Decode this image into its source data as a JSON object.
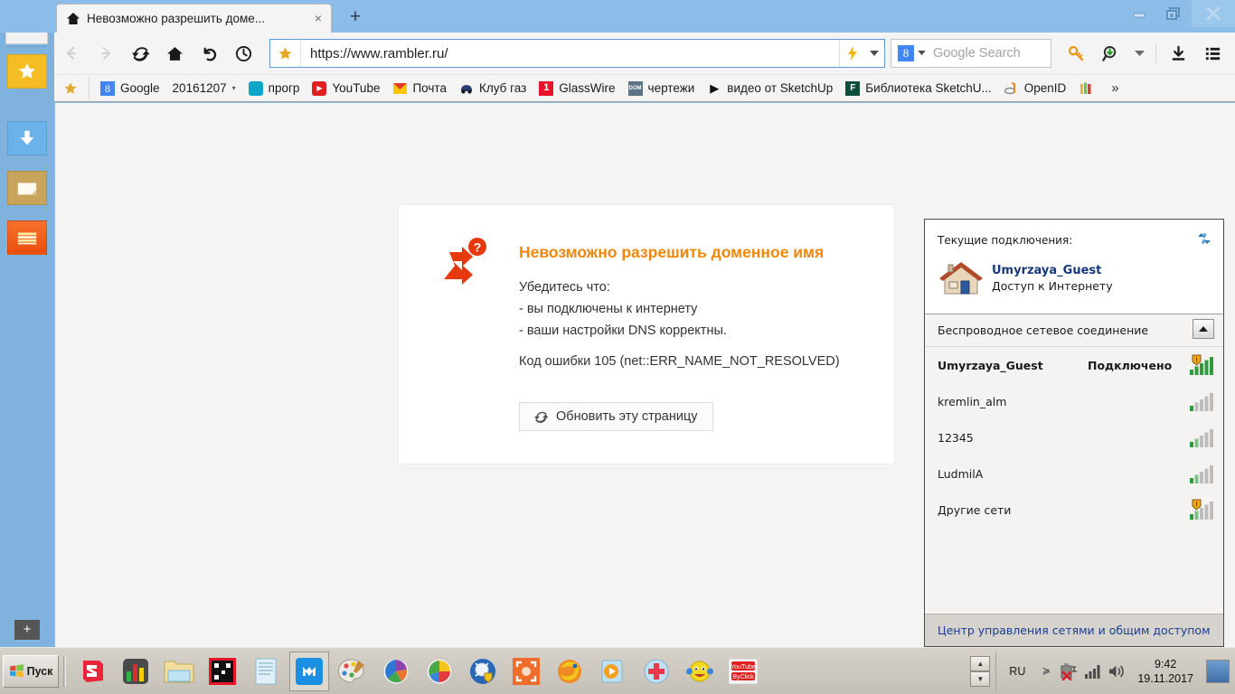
{
  "window": {
    "minimize_label": "Minimize",
    "maximize_label": "Restore",
    "close_label": "Close"
  },
  "tab": {
    "title": "Невозможно разрешить доме...",
    "close_label": "×",
    "newtab_label": "+",
    "home_icon": "home-icon"
  },
  "toolbar": {
    "back_label": "←",
    "forward_label": "→",
    "reload_label": "reload-icon",
    "home_label": "home-icon",
    "undo_label": "undo-icon",
    "history_label": "clock-icon",
    "url": "https://www.rambler.ru/",
    "star_icon": "star-icon",
    "lightning_icon": "lightning-icon",
    "caret_icon": "chevron-down-icon",
    "search_engine": "8",
    "search_placeholder": "Google Search",
    "key_icon": "key-icon",
    "resource_sniffer_icon": "magnifier-download-icon",
    "extras_caret": "chevron-down-icon",
    "download_icon": "download-icon",
    "menu_icon": "hamburger-menu-icon"
  },
  "bookmarks": {
    "star_label": "★",
    "items": [
      {
        "label": "Google",
        "icon": "google-icon",
        "icon_text": "8",
        "icon_bg": "#4285f4",
        "icon_color": "#ffffff"
      },
      {
        "label": "20161207",
        "icon": "folder-icon",
        "icon_text": "",
        "icon_bg": "transparent",
        "icon_color": "#555555",
        "caret": "▾"
      },
      {
        "label": "прогр",
        "icon": "square-icon",
        "icon_text": "",
        "icon_bg": "#0fa5c8",
        "icon_color": "#ffffff"
      },
      {
        "label": "YouTube",
        "icon": "youtube-icon",
        "icon_text": "▶",
        "icon_bg": "#e02020",
        "icon_color": "#ffffff"
      },
      {
        "label": "Почта",
        "icon": "mail-icon",
        "icon_text": "✉",
        "icon_bg": "#ffc400",
        "icon_color": "#d03030"
      },
      {
        "label": "Клуб газ",
        "icon": "car-icon",
        "icon_text": "",
        "icon_bg": "transparent",
        "icon_color": "#2a3b6e"
      },
      {
        "label": "GlassWire",
        "icon": "glasswire-icon",
        "icon_text": "1",
        "icon_bg": "#e8142c",
        "icon_color": "#ffffff"
      },
      {
        "label": "чертежи",
        "icon": "dom-icon",
        "icon_text": "DOM",
        "icon_bg": "#5d7388",
        "icon_color": "#ffffff"
      },
      {
        "label": "видео от SketchUp",
        "icon": "play-icon",
        "icon_text": "▶",
        "icon_bg": "transparent",
        "icon_color": "#111111"
      },
      {
        "label": "Библиотека SketchU...",
        "icon": "library-icon",
        "icon_text": "F",
        "icon_bg": "#0b4f3a",
        "icon_color": "#ffffff"
      },
      {
        "label": "OpenID",
        "icon": "openid-icon",
        "icon_text": "",
        "icon_bg": "transparent",
        "icon_color": "#f6871f"
      },
      {
        "label": "",
        "icon": "books-icon",
        "icon_text": "",
        "icon_bg": "transparent",
        "icon_color": "#d8a000"
      }
    ],
    "overflow_label": "»"
  },
  "sidebar": {
    "smiley_icon": "smiley-icon",
    "items": [
      {
        "name": "favorites",
        "icon": "star-icon",
        "label": "Избранное"
      },
      {
        "name": "downloads",
        "icon": "download-arrow-icon",
        "label": "Загрузки"
      },
      {
        "name": "notes",
        "icon": "note-icon",
        "label": "Заметки"
      },
      {
        "name": "books",
        "icon": "books-icon",
        "label": "Книги"
      }
    ],
    "add_label": "+"
  },
  "error_page": {
    "icon": "dns-error-icon",
    "title": "Невозможно разрешить доменное имя",
    "line1": "Убедитесь что:",
    "line2": "- вы подключены к интернету",
    "line3": "- ваши настройки DNS корректны.",
    "code": "Код ошибки 105 (net::ERR_NAME_NOT_RESOLVED)",
    "refresh_button": "Обновить эту страницу",
    "title_color": "#f0870a"
  },
  "network_flyout": {
    "current_label": "Текущие подключения:",
    "refresh_icon": "refresh-networks-icon",
    "current_ssid": "Umyrzaya_Guest",
    "current_access": "Доступ к Интернету",
    "section_label": "Беспроводное сетевое соединение",
    "collapse_label": "▲",
    "networks": [
      {
        "ssid": "Umyrzaya_Guest",
        "state": "Подключено",
        "bars": 5,
        "secured": true,
        "connected": true
      },
      {
        "ssid": "kremlin_alm",
        "state": "",
        "bars": 1,
        "secured": false,
        "connected": false
      },
      {
        "ssid": "12345",
        "state": "",
        "bars": 2,
        "secured": false,
        "connected": false
      },
      {
        "ssid": "LudmilA",
        "state": "",
        "bars": 2,
        "secured": false,
        "connected": false
      },
      {
        "ssid": "Другие сети",
        "state": "",
        "bars": 2,
        "secured": true,
        "connected": false
      }
    ],
    "footer_link": "Центр управления сетями и общим доступом",
    "link_color": "#1b3e8e"
  },
  "taskbar": {
    "start_label": "Пуск",
    "tasks": [
      {
        "name": "sketchup",
        "active": false
      },
      {
        "name": "chart-app",
        "active": false
      },
      {
        "name": "explorer",
        "active": false
      },
      {
        "name": "qr-app",
        "active": false
      },
      {
        "name": "notepad",
        "active": false
      },
      {
        "name": "maxthon",
        "active": true
      },
      {
        "name": "paint",
        "active": false
      },
      {
        "name": "picasa",
        "active": false
      },
      {
        "name": "color-wheel",
        "active": false
      },
      {
        "name": "antivirus",
        "active": false
      },
      {
        "name": "screen-capture",
        "active": false
      },
      {
        "name": "firefox",
        "active": false
      },
      {
        "name": "media-player",
        "active": false
      },
      {
        "name": "health-app",
        "active": false
      },
      {
        "name": "smiley-app",
        "active": false
      },
      {
        "name": "youtube-byclick",
        "active": false
      }
    ],
    "tray": {
      "scroll_up": "▲",
      "scroll_down": "▼",
      "language": "RU",
      "chevron": "≽",
      "battery_icon": "battery-error-icon",
      "signal_icon": "signal-bars-icon",
      "volume_icon": "volume-icon",
      "time": "9:42",
      "date": "19.11.2017",
      "show_desktop_label": "Свернуть все окна"
    }
  }
}
